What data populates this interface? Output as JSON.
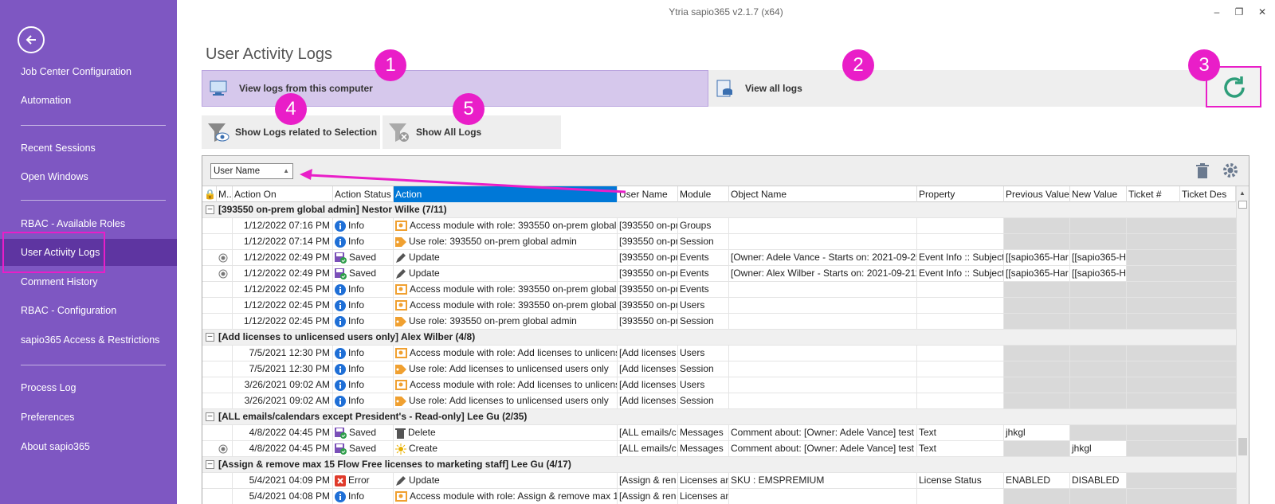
{
  "app_title": "Ytria sapio365 v2.1.7 (x64)",
  "sidebar": {
    "items": [
      {
        "label": "Job Center Configuration"
      },
      {
        "label": "Automation"
      },
      {
        "label": "Recent Sessions"
      },
      {
        "label": "Open Windows"
      },
      {
        "label": "RBAC - Available Roles"
      },
      {
        "label": "User Activity Logs"
      },
      {
        "label": "Comment History"
      },
      {
        "label": "RBAC - Configuration"
      },
      {
        "label": "sapio365 Access & Restrictions"
      },
      {
        "label": "Process Log"
      },
      {
        "label": "Preferences"
      },
      {
        "label": "About sapio365"
      }
    ]
  },
  "page_title": "User Activity Logs",
  "tabs": {
    "local": "View logs from this computer",
    "all": "View all logs"
  },
  "buttons": {
    "related": "Show Logs related to Selection",
    "all": "Show All Logs"
  },
  "callouts": [
    "1",
    "2",
    "3",
    "4",
    "5"
  ],
  "group_by": "User Name",
  "columns": [
    "M..",
    "Action On",
    "Action Status",
    "Action",
    "User Name",
    "Module",
    "Object Name",
    "Property",
    "Previous Value",
    "New Value",
    "Ticket #",
    "Ticket Des"
  ],
  "groups": [
    {
      "title": "[393550 on-prem global admin] Nestor Wilke (7/11)",
      "rows": [
        {
          "m": "",
          "date": "1/12/2022 07:16 PM",
          "status": "Info",
          "action": "Access module with role: 393550 on-prem global",
          "user": "[393550 on-pr",
          "module": "Groups",
          "object": "",
          "property": "",
          "prev": "",
          "new": ""
        },
        {
          "m": "",
          "date": "1/12/2022 07:14 PM",
          "status": "Info",
          "action": "Use role: 393550 on-prem global admin",
          "user": "[393550 on-pr",
          "module": "Session",
          "object": "",
          "property": "",
          "prev": "",
          "new": ""
        },
        {
          "m": "o",
          "date": "1/12/2022 02:49 PM",
          "status": "Saved",
          "action": "Update",
          "user": "[393550 on-pr",
          "module": "Events",
          "object": "[Owner: Adele Vance - Starts on: 2021-09-25",
          "property": "Event Info :: Subject",
          "prev": "[[sapio365-Har",
          "new": "[[sapio365-H"
        },
        {
          "m": "o",
          "date": "1/12/2022 02:49 PM",
          "status": "Saved",
          "action": "Update",
          "user": "[393550 on-pr",
          "module": "Events",
          "object": "[Owner: Alex Wilber - Starts on: 2021-09-211",
          "property": "Event Info :: Subject",
          "prev": "[[sapio365-Har",
          "new": "[[sapio365-H"
        },
        {
          "m": "",
          "date": "1/12/2022 02:45 PM",
          "status": "Info",
          "action": "Access module with role: 393550 on-prem global",
          "user": "[393550 on-pr",
          "module": "Events",
          "object": "",
          "property": "",
          "prev": "",
          "new": ""
        },
        {
          "m": "",
          "date": "1/12/2022 02:45 PM",
          "status": "Info",
          "action": "Access module with role: 393550 on-prem global",
          "user": "[393550 on-pr",
          "module": "Users",
          "object": "",
          "property": "",
          "prev": "",
          "new": ""
        },
        {
          "m": "",
          "date": "1/12/2022 02:45 PM",
          "status": "Info",
          "action": "Use role: 393550 on-prem global admin",
          "user": "[393550 on-pr",
          "module": "Session",
          "object": "",
          "property": "",
          "prev": "",
          "new": ""
        }
      ]
    },
    {
      "title": "[Add licenses to unlicensed users only] Alex Wilber (4/8)",
      "rows": [
        {
          "m": "",
          "date": "7/5/2021 12:30 PM",
          "status": "Info",
          "action": "Access module with role: Add licenses to unlicens",
          "user": "[Add licenses",
          "module": "Users",
          "object": "",
          "property": "",
          "prev": "",
          "new": ""
        },
        {
          "m": "",
          "date": "7/5/2021 12:30 PM",
          "status": "Info",
          "action": "Use role: Add licenses to unlicensed users only",
          "user": "[Add licenses",
          "module": "Session",
          "object": "",
          "property": "",
          "prev": "",
          "new": ""
        },
        {
          "m": "",
          "date": "3/26/2021 09:02 AM",
          "status": "Info",
          "action": "Access module with role: Add licenses to unlicens",
          "user": "[Add licenses",
          "module": "Users",
          "object": "",
          "property": "",
          "prev": "",
          "new": ""
        },
        {
          "m": "",
          "date": "3/26/2021 09:02 AM",
          "status": "Info",
          "action": "Use role: Add licenses to unlicensed users only",
          "user": "[Add licenses",
          "module": "Session",
          "object": "",
          "property": "",
          "prev": "",
          "new": ""
        }
      ]
    },
    {
      "title": "[ALL emails/calendars except President's - Read-only] Lee Gu (2/35)",
      "rows": [
        {
          "m": "",
          "date": "4/8/2022 04:45 PM",
          "status": "Saved",
          "action": "Delete",
          "user": "[ALL emails/c",
          "module": "Messages",
          "object": "Comment about: [Owner: Adele Vance] test",
          "property": "Text",
          "prev": "jhkgl",
          "new": ""
        },
        {
          "m": "o",
          "date": "4/8/2022 04:45 PM",
          "status": "Saved",
          "action": "Create",
          "user": "[ALL emails/c",
          "module": "Messages",
          "object": "Comment about: [Owner: Adele Vance] test",
          "property": "Text",
          "prev": "",
          "new": "jhkgl"
        }
      ]
    },
    {
      "title": "[Assign & remove max 15 Flow Free licenses to marketing staff] Lee Gu (4/17)",
      "rows": [
        {
          "m": "",
          "date": "5/4/2021 04:09 PM",
          "status": "Error",
          "action": "Update",
          "user": "[Assign & ren",
          "module": "Licenses an",
          "object": "SKU : EMSPREMIUM",
          "property": "License Status",
          "prev": "ENABLED",
          "new": "DISABLED"
        },
        {
          "m": "",
          "date": "5/4/2021 04:08 PM",
          "status": "Info",
          "action": "Access module with role: Assign & remove max 1",
          "user": "[Assign & ren",
          "module": "Licenses an",
          "object": "",
          "property": "",
          "prev": "",
          "new": ""
        }
      ]
    }
  ],
  "colors": {
    "sidebar": "#7e57c2",
    "sidebar_active": "#5e35a1",
    "highlight": "#e91ec8",
    "selected_header": "#0078d7",
    "refresh": "#2e9e7a"
  }
}
